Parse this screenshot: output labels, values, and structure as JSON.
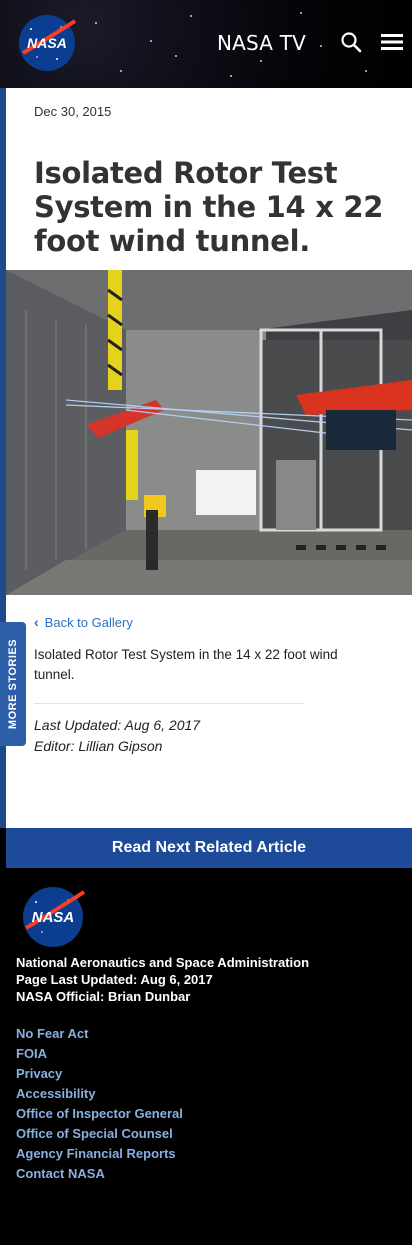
{
  "header": {
    "logo_text": "NASA",
    "nav_title": "NASA TV",
    "icons": [
      "search-icon",
      "menu-icon"
    ]
  },
  "article": {
    "date": "Dec 30, 2015",
    "title": "Isolated Rotor Test System in the 14 x 22 foot wind tunnel.",
    "image_alt": "Isolated Rotor Test System in the 14 x 22 foot wind tunnel.",
    "back_label": "Back to Gallery",
    "caption": "Isolated Rotor Test System in the 14 x 22 foot wind tunnel.",
    "last_updated": "Last Updated: Aug 6, 2017",
    "editor": "Editor: Lillian Gipson"
  },
  "more_stories_label": "MORE STORIES",
  "read_next_label": "Read Next Related Article",
  "footer": {
    "logo_text": "NASA",
    "agency": "National Aeronautics and Space Administration",
    "page_updated": "Page Last Updated: Aug 6, 2017",
    "official": "NASA Official: Brian Dunbar",
    "links": [
      "No Fear Act",
      "FOIA",
      "Privacy",
      "Accessibility",
      "Office of Inspector General",
      "Office of Special Counsel",
      "Agency Financial Reports",
      "Contact NASA"
    ]
  },
  "colors": {
    "header_bg": "#000000",
    "accent_blue": "#1e4a9a",
    "link_blue": "#2a72c4",
    "footer_link": "#8ab0e0"
  }
}
